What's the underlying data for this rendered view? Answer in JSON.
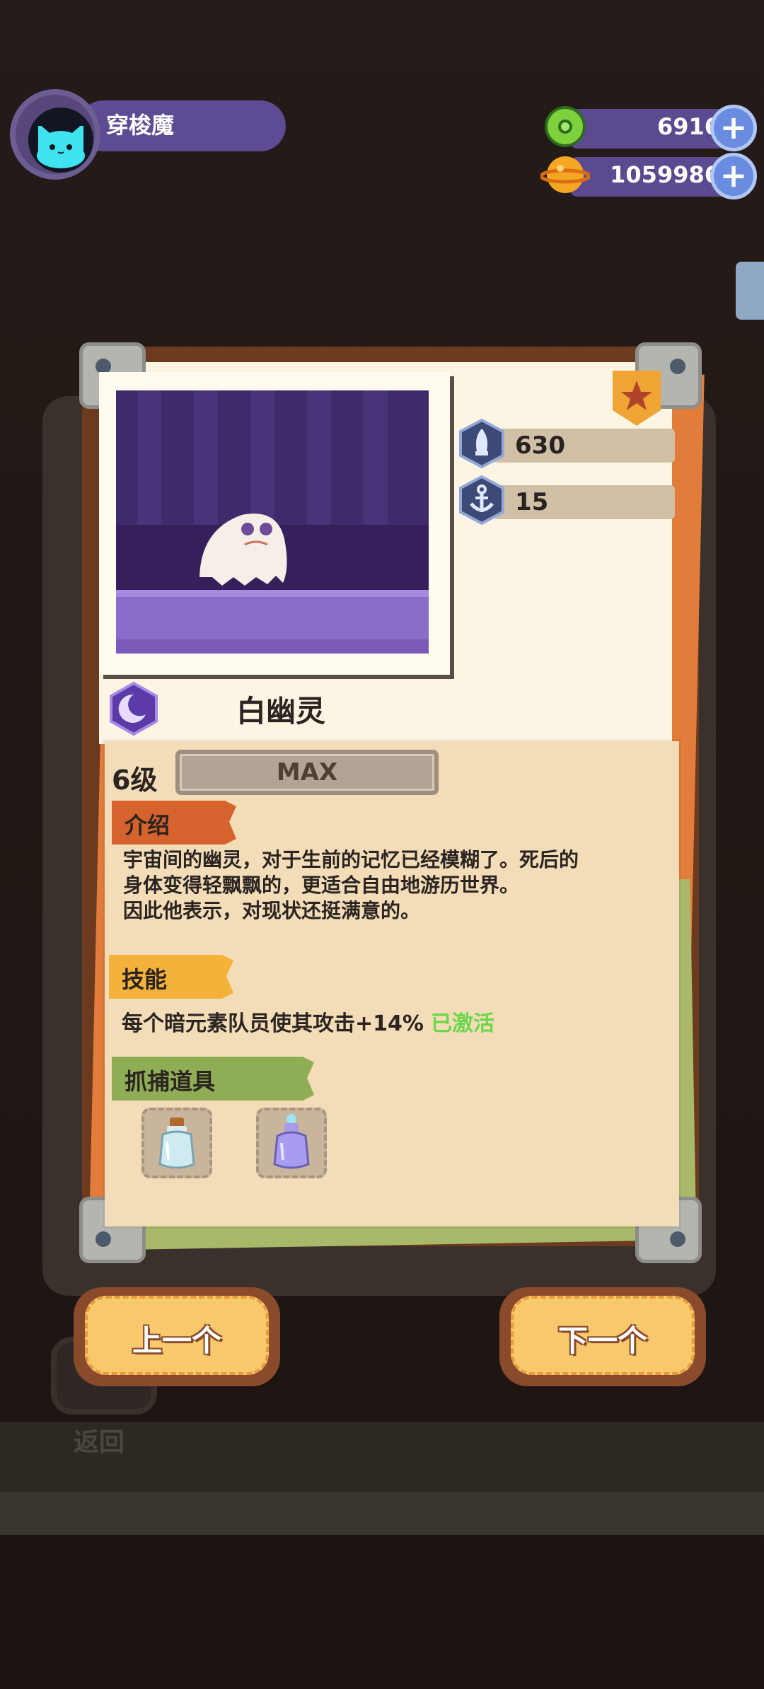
{
  "player": {
    "name": "穿梭魔",
    "avatar_icon": "cat-face-icon"
  },
  "currencies": [
    {
      "icon": "green-donut-coin-icon",
      "value": "6916",
      "add_icon": "plus-icon"
    },
    {
      "icon": "orange-planet-coin-icon",
      "value": "1059986",
      "add_icon": "plus-icon"
    }
  ],
  "creature": {
    "name": "白幽灵",
    "element_icon": "dark-moon-element-icon",
    "rarity_icon": "star-badge-icon",
    "stats": [
      {
        "icon": "attack-blade-icon",
        "value": "630"
      },
      {
        "icon": "anchor-icon",
        "value": "15"
      }
    ],
    "level": "6级",
    "level_status": "MAX"
  },
  "sections": {
    "intro": {
      "title": "介绍",
      "lines": [
        "宇宙间的幽灵，对于生前的记忆已经模糊了。死后的",
        "身体变得轻飘飘的，更适合自由地游历世界。",
        "因此他表示，对现状还挺满意的。"
      ]
    },
    "skill": {
      "title": "技能",
      "text": "每个暗元素队员使其攻击+14%",
      "status": "已激活"
    },
    "capture": {
      "title": "抓捕道具",
      "items": [
        {
          "icon": "cork-bottle-icon"
        },
        {
          "icon": "purple-potion-bottle-icon"
        }
      ]
    }
  },
  "nav": {
    "prev": "上一个",
    "next": "下一个",
    "back": "返回"
  },
  "colors": {
    "panel_purple": "#5d4b93",
    "skill_active": "#6cd64a",
    "paper": "#f3ddb8"
  }
}
